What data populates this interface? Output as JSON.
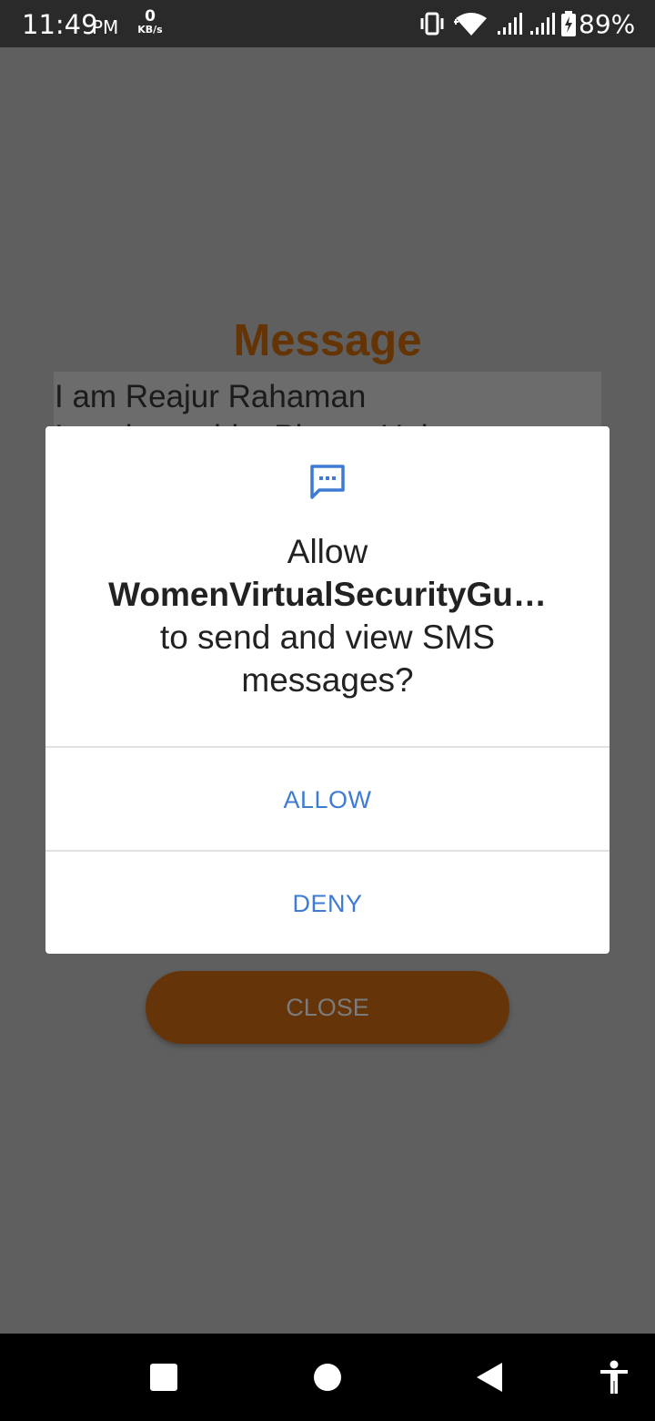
{
  "status_bar": {
    "time": "11:49",
    "ampm": "PM",
    "net_speed_value": "0",
    "net_speed_unit": "KB/s",
    "battery_percent": "89%",
    "icons": [
      "vibrate-icon",
      "wifi-icon",
      "signal-icon",
      "signal-icon",
      "battery-charging-icon"
    ]
  },
  "app": {
    "title": "Message",
    "message_text": "I am Reajur Rahaman\nI am in trouble. Please Help",
    "close_label": "CLOSE"
  },
  "dialog": {
    "icon": "sms-icon",
    "line1": "Allow",
    "app_name": "WomenVirtualSecurityGu…",
    "line3": "to send and view SMS messages?",
    "allow_label": "ALLOW",
    "deny_label": "DENY"
  },
  "nav_bar": {
    "icons": [
      "recents-icon",
      "home-icon",
      "back-icon",
      "accessibility-icon"
    ]
  },
  "colors": {
    "accent_blue": "#3F7BD3",
    "brand_brown": "#653405",
    "scrim": "#5F5F5F"
  }
}
